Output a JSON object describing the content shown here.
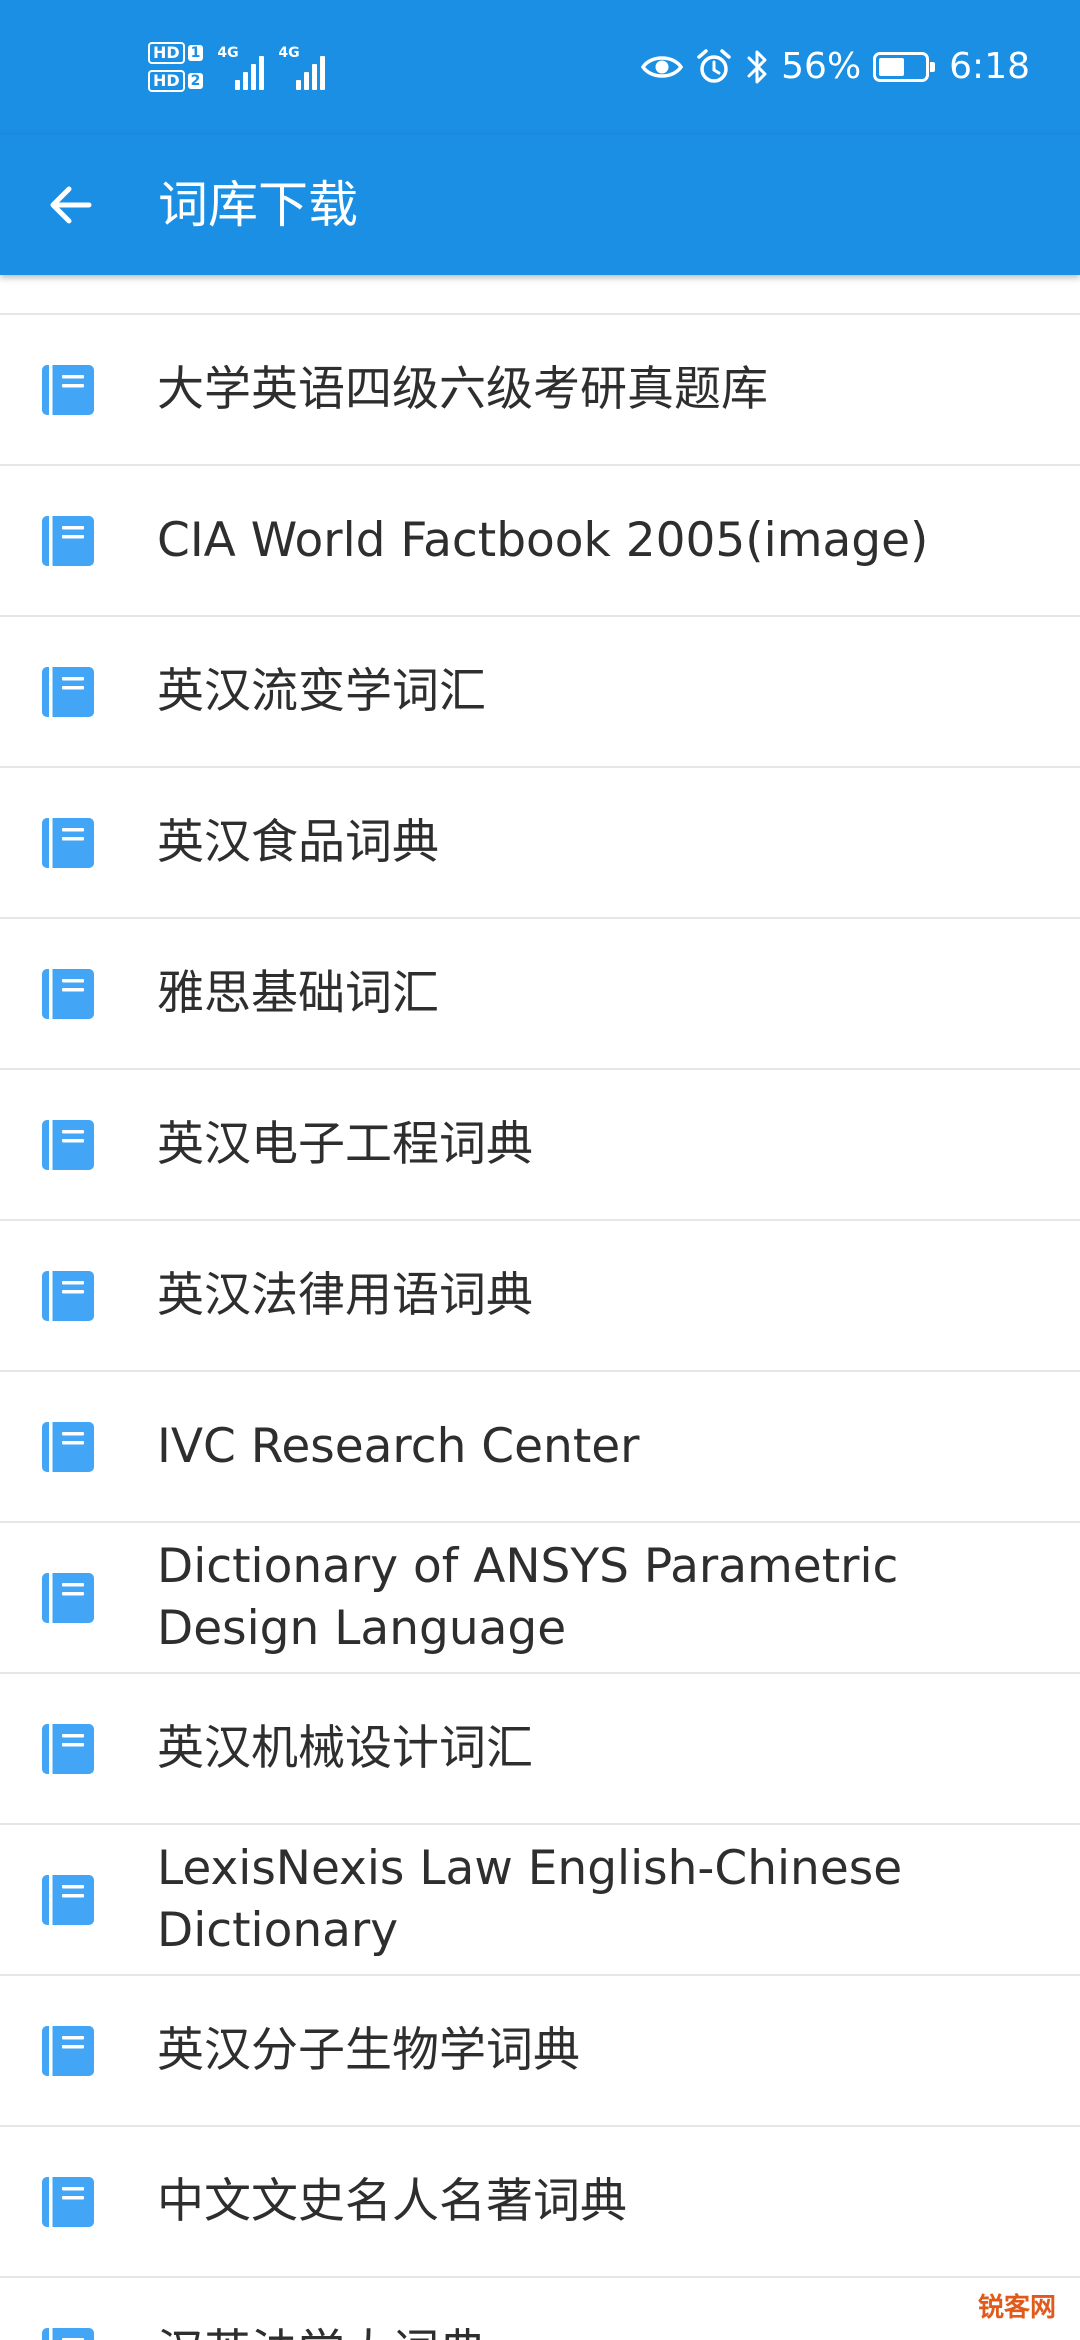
{
  "status_bar": {
    "sim1_badge": "HD",
    "sim1_num": "1",
    "sim2_badge": "HD",
    "sim2_num": "2",
    "network1": "4G",
    "network2": "4G",
    "battery_percent": "56%",
    "battery_level": 0.56,
    "time": "6:18",
    "icons": [
      "eye-icon",
      "alarm-icon",
      "bluetooth-icon",
      "battery-icon"
    ]
  },
  "app_bar": {
    "title": "词库下载",
    "back_icon": "arrow-left-icon",
    "background_color": "#1a8fe3"
  },
  "list": {
    "item_icon": "book-icon",
    "icon_color": "#42a5f5",
    "items": [
      {
        "label": "大学英语四级六级考研真题库"
      },
      {
        "label": "CIA World Factbook 2005(image)"
      },
      {
        "label": "英汉流变学词汇"
      },
      {
        "label": "英汉食品词典"
      },
      {
        "label": "雅思基础词汇"
      },
      {
        "label": "英汉电子工程词典"
      },
      {
        "label": "英汉法律用语词典"
      },
      {
        "label": "IVC Research Center"
      },
      {
        "label": "Dictionary of ANSYS Parametric Design Language"
      },
      {
        "label": "英汉机械设计词汇"
      },
      {
        "label": "LexisNexis Law English-Chinese Dictionary"
      },
      {
        "label": "英汉分子生物学词典"
      },
      {
        "label": "中文文史名人名著词典"
      },
      {
        "label": "汉英法学大词典"
      }
    ]
  },
  "watermark": "锐客网"
}
